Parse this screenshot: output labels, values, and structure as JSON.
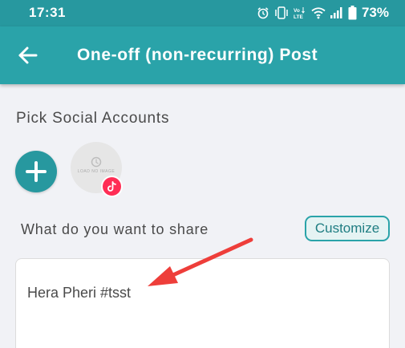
{
  "status_bar": {
    "time": "17:31",
    "battery_percent": "73%",
    "icons": [
      "alarm-icon",
      "vibrate-icon",
      "volte-icon",
      "wifi-icon",
      "signal-icon",
      "battery-icon"
    ]
  },
  "app_bar": {
    "title": "One-off (non-recurring) Post",
    "back_icon": "back-arrow-icon"
  },
  "accounts": {
    "section_label": "Pick Social Accounts",
    "add_icon": "plus-icon",
    "avatar_caption": "LOAD NO IMAGE",
    "badge_icon": "tiktok-icon"
  },
  "share": {
    "label": "What do you want to share",
    "customize_label": "Customize",
    "post_text": "Hera Pheri #tsst"
  },
  "colors": {
    "primary": "#2aa3a9",
    "status_bar": "#27989f",
    "annotation_arrow": "#ee3e3a",
    "tiktok_badge": "#ff2d55"
  }
}
